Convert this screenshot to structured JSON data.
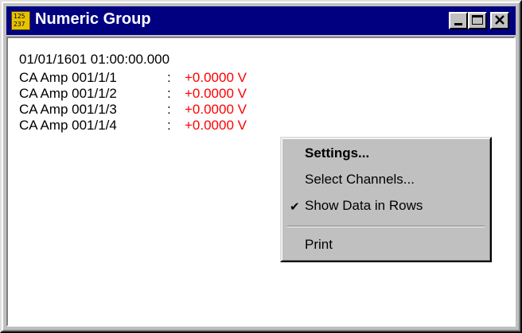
{
  "window": {
    "title": "Numeric Group",
    "icon": "numeric-group-icon",
    "icon_text": "125\n237"
  },
  "content": {
    "timestamp": "01/01/1601 01:00:00.000",
    "channels": [
      {
        "name": "CA Amp 001/1/1",
        "separator": ":",
        "value": "+0.0000 V"
      },
      {
        "name": "CA Amp 001/1/2",
        "separator": ":",
        "value": "+0.0000 V"
      },
      {
        "name": "CA Amp 001/1/3",
        "separator": ":",
        "value": "+0.0000 V"
      },
      {
        "name": "CA Amp 001/1/4",
        "separator": ":",
        "value": "+0.0000 V"
      }
    ],
    "value_color": "#ff0000"
  },
  "context_menu": {
    "items": [
      {
        "label": "Settings...",
        "bold": true,
        "checked": false
      },
      {
        "label": "Select Channels...",
        "bold": false,
        "checked": false
      },
      {
        "label": "Show Data in Rows",
        "bold": false,
        "checked": true
      },
      {
        "label": "Print",
        "bold": false,
        "checked": false
      }
    ],
    "check_glyph": "✔"
  },
  "colors": {
    "titlebar": "#000080",
    "face": "#c0c0c0",
    "value": "#ff0000"
  }
}
